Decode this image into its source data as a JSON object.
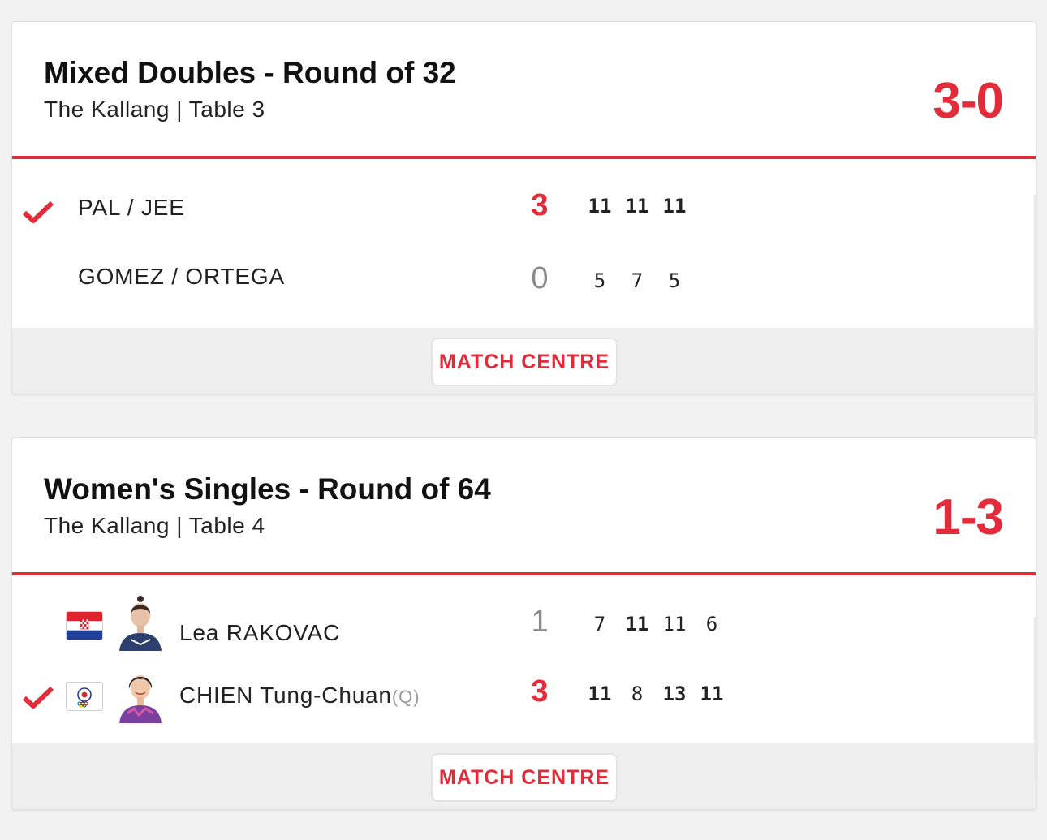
{
  "colors": {
    "accent": "#e32b3a",
    "muted": "#8a8a8a",
    "footer_bg": "#efefef"
  },
  "matches": [
    {
      "title": "Mixed Doubles - Round of 32",
      "venue": "The Kallang | Table 3",
      "score": "3-0",
      "match_centre_label": "MATCH CENTRE",
      "players": [
        {
          "name": "PAL / JEE",
          "winner": true,
          "games_won": "3",
          "games": [
            "11",
            "11",
            "11"
          ],
          "won_games": [
            true,
            true,
            true
          ]
        },
        {
          "name": "GOMEZ / ORTEGA",
          "winner": false,
          "games_won": "0",
          "games": [
            "5",
            "7",
            "5"
          ],
          "won_games": [
            false,
            false,
            false
          ]
        }
      ]
    },
    {
      "title": "Women's Singles - Round of 64",
      "venue": "The Kallang | Table 4",
      "score": "1-3",
      "match_centre_label": "MATCH CENTRE",
      "players": [
        {
          "name": "Lea RAKOVAC",
          "qualifier": "",
          "flag_icon": "croatia-flag-icon",
          "winner": false,
          "games_won": "1",
          "games": [
            "7",
            "11",
            "11",
            "6"
          ],
          "won_games": [
            false,
            true,
            false,
            false
          ]
        },
        {
          "name": "CHIEN Tung-Chuan",
          "qualifier": "(Q)",
          "flag_icon": "chinese-taipei-flag-icon",
          "winner": true,
          "games_won": "3",
          "games": [
            "11",
            "8",
            "13",
            "11"
          ],
          "won_games": [
            true,
            false,
            true,
            true
          ]
        }
      ]
    }
  ]
}
